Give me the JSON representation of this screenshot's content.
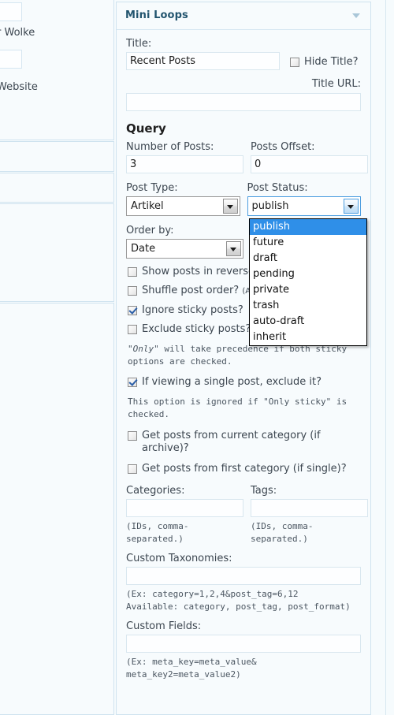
{
  "background_column": {
    "texts": [
      "r Wolke",
      "Website"
    ]
  },
  "widget": {
    "header_title": "Mini Loops",
    "toggle_icon": "chevron-down-icon",
    "title_label": "Title:",
    "title_value": "Recent Posts",
    "hide_title_label": "Hide Title?",
    "hide_title_checked": false,
    "title_url_label": "Title URL:",
    "title_url_value": "",
    "query_heading": "Query",
    "number_of_posts_label": "Number of Posts:",
    "number_of_posts_value": "3",
    "posts_offset_label": "Posts Offset:",
    "posts_offset_value": "0",
    "post_type_label": "Post Type:",
    "post_type_value": "Artikel",
    "post_status_label": "Post Status:",
    "post_status_value": "publish",
    "post_status_options": [
      "publish",
      "future",
      "draft",
      "pending",
      "private",
      "trash",
      "auto-draft",
      "inherit"
    ],
    "post_status_selected_index": 0,
    "order_by_label": "Order by:",
    "order_by_value": "Date",
    "checkboxes": [
      {
        "label": "Show posts in reverse",
        "checked": false
      },
      {
        "label": "Shuffle post order? ",
        "suffix": "(AB",
        "checked": false
      },
      {
        "label": "Ignore sticky posts?",
        "checked": true
      },
      {
        "label": "Exclude sticky posts?",
        "checked": false
      }
    ],
    "sticky_hint_italic": "Only",
    "sticky_hint_rest": "\" will take precedence if both sticky options are checked.",
    "sticky_hint_prefix": "\"",
    "single_post_label": "If viewing a single post, exclude it?",
    "single_post_checked": true,
    "single_post_hint": "This option is ignored if \"Only sticky\" is checked.",
    "current_category_label": "Get posts from current category (if archive)?",
    "current_category_checked": false,
    "first_category_label": "Get posts from first category (if single)?",
    "first_category_checked": false,
    "categories_label": "Categories:",
    "categories_value": "",
    "categories_hint": "(IDs, comma-separated.)",
    "tags_label": "Tags:",
    "tags_value": "",
    "tags_hint": "(IDs, comma-separated.)",
    "custom_taxonomies_label": "Custom Taxonomies:",
    "custom_taxonomies_value": "",
    "custom_taxonomies_hint_1": "(Ex: category=1,2,4&post_tag=6,12",
    "custom_taxonomies_hint_2": "Available: category, post_tag, post_format)",
    "custom_fields_label": "Custom Fields:",
    "custom_fields_value": "",
    "custom_fields_hint_1": "(Ex: meta_key=meta_value&",
    "custom_fields_hint_2": "meta_key2=meta_value2)"
  },
  "colors": {
    "accent": "#2f8fe8",
    "header_title": "#22546e",
    "panel_bg": "#f7fbfd",
    "panel_border": "#cfe3ef"
  }
}
